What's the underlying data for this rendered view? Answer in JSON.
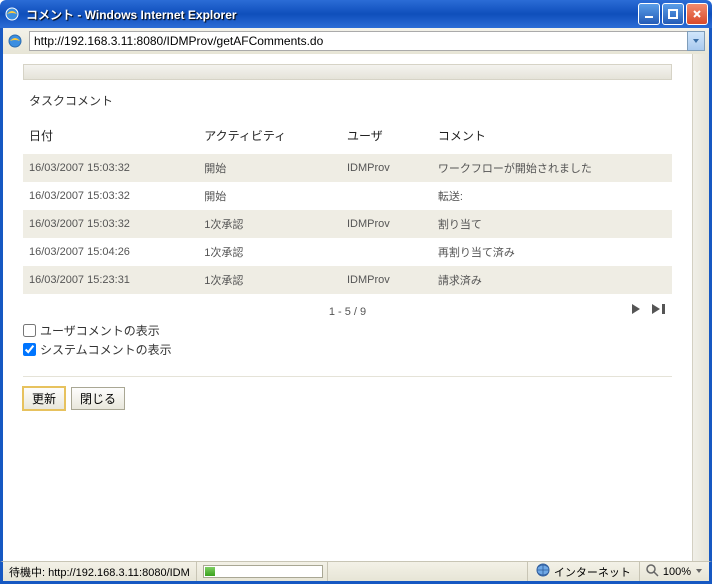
{
  "window": {
    "title": "コメント - Windows Internet Explorer"
  },
  "address": {
    "url": "http://192.168.3.11:8080/IDMProv/getAFComments.do"
  },
  "section_title": "タスクコメント",
  "columns": {
    "date": "日付",
    "activity": "アクティビティ",
    "user": "ユーザ",
    "comment": "コメント"
  },
  "rows": [
    {
      "date": "16/03/2007 15:03:32",
      "activity": "開始",
      "user": "IDMProv",
      "comment": "ワークフローが開始されました"
    },
    {
      "date": "16/03/2007 15:03:32",
      "activity": "開始",
      "user": "",
      "comment": "転送:"
    },
    {
      "date": "16/03/2007 15:03:32",
      "activity": "1次承認",
      "user": "IDMProv",
      "comment": "割り当て"
    },
    {
      "date": "16/03/2007 15:04:26",
      "activity": "1次承認",
      "user": "",
      "comment": "再割り当て済み"
    },
    {
      "date": "16/03/2007 15:23:31",
      "activity": "1次承認",
      "user": "IDMProv",
      "comment": "請求済み"
    }
  ],
  "pager": {
    "range": "1 - 5 / 9"
  },
  "checkboxes": {
    "user_comments_label": "ユーザコメントの表示",
    "system_comments_label": "システムコメントの表示",
    "user_checked": false,
    "system_checked": true
  },
  "buttons": {
    "refresh": "更新",
    "close": "閉じる"
  },
  "status": {
    "loading_text": "待機中: http://192.168.3.11:8080/IDM",
    "zone": "インターネット",
    "zoom": "100%"
  },
  "chart_data": {
    "type": "table",
    "title": "タスクコメント",
    "columns": [
      "日付",
      "アクティビティ",
      "ユーザ",
      "コメント"
    ],
    "rows": [
      [
        "16/03/2007 15:03:32",
        "開始",
        "IDMProv",
        "ワークフローが開始されました"
      ],
      [
        "16/03/2007 15:03:32",
        "開始",
        "",
        "転送:"
      ],
      [
        "16/03/2007 15:03:32",
        "1次承認",
        "IDMProv",
        "割り当て"
      ],
      [
        "16/03/2007 15:04:26",
        "1次承認",
        "",
        "再割り当て済み"
      ],
      [
        "16/03/2007 15:23:31",
        "1次承認",
        "IDMProv",
        "請求済み"
      ]
    ]
  }
}
